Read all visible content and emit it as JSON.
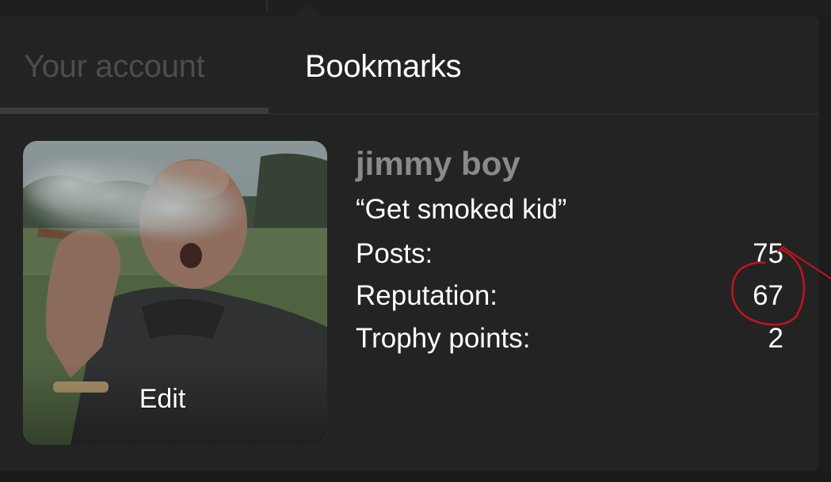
{
  "tabs": [
    {
      "label": "Your account",
      "active": false
    },
    {
      "label": "Bookmarks",
      "active": true
    }
  ],
  "profile": {
    "avatar_action": "Edit",
    "username": "jimmy boy",
    "custom_title": "“Get smoked kid”",
    "stats": [
      {
        "label": "Posts:",
        "value": "75"
      },
      {
        "label": "Reputation:",
        "value": "67"
      },
      {
        "label": "Trophy points:",
        "value": "2"
      }
    ]
  },
  "colors": {
    "panel_background": "#232323",
    "active_tab_text": "#ffffff",
    "inactive_tab_text": "#4d4d4d",
    "username_text": "#8a8a8a",
    "annotation_red": "#c4141c"
  }
}
